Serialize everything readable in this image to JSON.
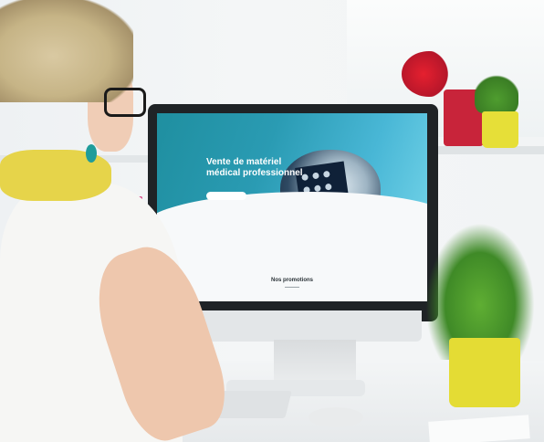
{
  "website": {
    "hero_title": "Vente de matériel médical professionnel",
    "hero_button": "",
    "features": [
      {
        "title": ""
      },
      {
        "title": ""
      },
      {
        "title": ""
      }
    ],
    "promotions_heading": "Nos promotions"
  }
}
